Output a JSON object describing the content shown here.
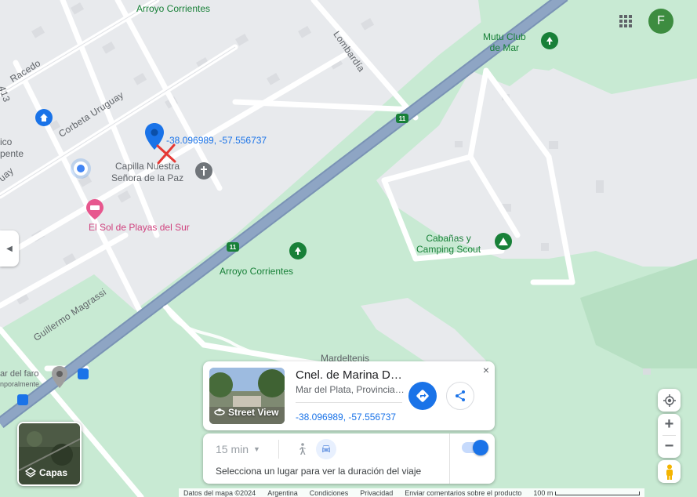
{
  "map": {
    "labels": {
      "arroyo_top": "Arroyo Corrientes",
      "arroyo_center": "Arroyo Corrientes",
      "mutu_club_line1": "Mutu Club",
      "mutu_club_line2": "de Mar",
      "capilla_line1": "Capilla Nuestra",
      "capilla_line2": "Señora de la Paz",
      "el_sol": "El Sol de Playas del Sur",
      "cabanas_line1": "Cabañas y",
      "cabanas_line2": "Camping Scout",
      "mardeltenis": "Mardeltenis",
      "faro_line1": "ar del faro",
      "faro_line2": "nporalmente",
      "ico": "ico",
      "pente": "pente",
      "uay": "uay"
    },
    "streets": {
      "racedo": "Racedo",
      "corbeta": "Corbeta Uruguay",
      "lombardia": "Lombardía",
      "magrassi": "Guillermo Magrassi",
      "route_413": "413"
    },
    "route_number": "11",
    "pin_coords": "-38.096989, -57.556737"
  },
  "header": {
    "avatar_letter": "F"
  },
  "card": {
    "title": "Cnel. de Marina Da...",
    "subtitle": "Mar del Plata, Provincia ...",
    "coords": "-38.096989, -57.556737",
    "street_view_label": "Street View",
    "close": "×"
  },
  "travel": {
    "time": "15 min",
    "hint": "Selecciona un lugar para ver la duración del viaje"
  },
  "layers": {
    "label": "Capas"
  },
  "footer": {
    "map_data": "Datos del mapa ©2024",
    "country": "Argentina",
    "terms": "Condiciones",
    "privacy": "Privacidad",
    "feedback": "Enviar comentarios sobre el producto",
    "scale": "100 m"
  },
  "colors": {
    "park_green": "#c8ead3",
    "highway": "#8ea5c4",
    "accent_blue": "#1a73e8",
    "pin_red_x": "#e53935"
  },
  "icons": {
    "apps": "grid-apps-icon",
    "directions": "directions-icon",
    "share": "share-icon",
    "walk": "walk-icon",
    "car": "car-icon",
    "locate": "my-location-icon",
    "pegman": "pegman-icon",
    "layers": "layers-icon"
  }
}
